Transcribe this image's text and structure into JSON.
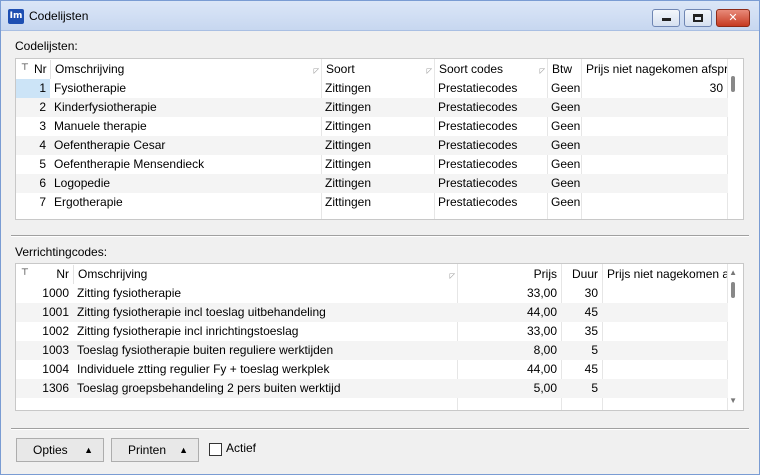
{
  "window": {
    "app_icon_text": "Im",
    "title": "Codelijsten"
  },
  "codelijsten": {
    "label": "Codelijsten:",
    "columns": {
      "nr": "Nr",
      "omschrijving": "Omschrijving",
      "soort": "Soort",
      "soort_codes": "Soort codes",
      "btw": "Btw",
      "prijs": "Prijs niet nagekomen afspr"
    },
    "rows": [
      {
        "nr": "1",
        "omschrijving": "Fysiotherapie",
        "soort": "Zittingen",
        "soort_codes": "Prestatiecodes",
        "btw": "Geen",
        "prijs": "30"
      },
      {
        "nr": "2",
        "omschrijving": "Kinderfysiotherapie",
        "soort": "Zittingen",
        "soort_codes": "Prestatiecodes",
        "btw": "Geen",
        "prijs": ""
      },
      {
        "nr": "3",
        "omschrijving": "Manuele therapie",
        "soort": "Zittingen",
        "soort_codes": "Prestatiecodes",
        "btw": "Geen",
        "prijs": ""
      },
      {
        "nr": "4",
        "omschrijving": "Oefentherapie Cesar",
        "soort": "Zittingen",
        "soort_codes": "Prestatiecodes",
        "btw": "Geen",
        "prijs": ""
      },
      {
        "nr": "5",
        "omschrijving": "Oefentherapie Mensendieck",
        "soort": "Zittingen",
        "soort_codes": "Prestatiecodes",
        "btw": "Geen",
        "prijs": ""
      },
      {
        "nr": "6",
        "omschrijving": "Logopedie",
        "soort": "Zittingen",
        "soort_codes": "Prestatiecodes",
        "btw": "Geen",
        "prijs": ""
      },
      {
        "nr": "7",
        "omschrijving": "Ergotherapie",
        "soort": "Zittingen",
        "soort_codes": "Prestatiecodes",
        "btw": "Geen",
        "prijs": ""
      }
    ]
  },
  "verrichtingcodes": {
    "label": "Verrichtingcodes:",
    "columns": {
      "nr": "Nr",
      "omschrijving": "Omschrijving",
      "prijs": "Prijs",
      "duur": "Duur",
      "prijs_niet": "Prijs niet nagekomen a"
    },
    "rows": [
      {
        "nr": "1000",
        "omschrijving": "Zitting fysiotherapie",
        "prijs": "33,00",
        "duur": "30"
      },
      {
        "nr": "1001",
        "omschrijving": "Zitting fysiotherapie incl toeslag uitbehandeling",
        "prijs": "44,00",
        "duur": "45"
      },
      {
        "nr": "1002",
        "omschrijving": "Zitting fysiotherapie incl inrichtingstoeslag",
        "prijs": "33,00",
        "duur": "35"
      },
      {
        "nr": "1003",
        "omschrijving": "Toeslag fysiotherapie buiten reguliere werktijden",
        "prijs": "8,00",
        "duur": "5"
      },
      {
        "nr": "1004",
        "omschrijving": "Individuele ztting regulier Fy + toeslag werkplek",
        "prijs": "44,00",
        "duur": "45"
      },
      {
        "nr": "1306",
        "omschrijving": "Toeslag groepsbehandeling 2 pers buiten werktijd",
        "prijs": "5,00",
        "duur": "5"
      }
    ]
  },
  "footer": {
    "opties_label": "Opties",
    "printen_label": "Printen",
    "actief_label": "Actief",
    "actief_checked": false
  }
}
